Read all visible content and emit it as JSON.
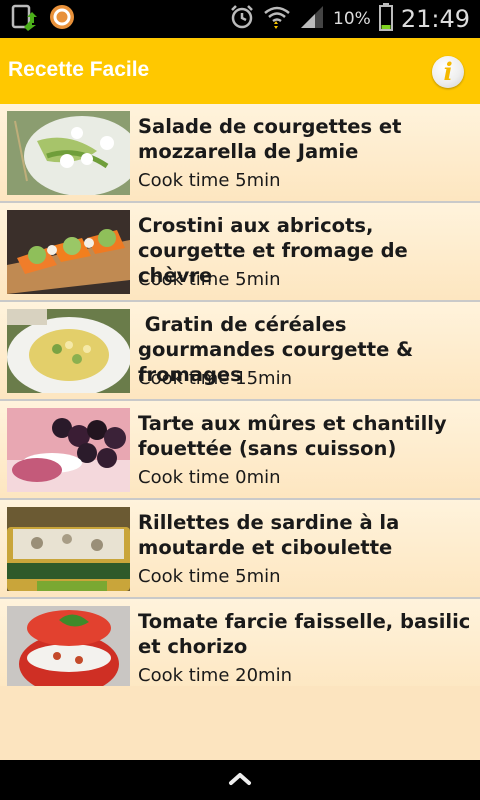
{
  "status_bar": {
    "battery_percent": "10%",
    "time": "21:49",
    "icons": [
      "upload-notification-icon",
      "app-notification-icon",
      "alarm-icon",
      "wifi-icon",
      "signal-icon",
      "battery-icon"
    ]
  },
  "action_bar": {
    "title": "Recette Facile",
    "info_icon": "info-icon",
    "accent_color": "#ffc800"
  },
  "recipes": [
    {
      "title": "Salade de courgettes et mozzarella de Jamie",
      "cook_time": "Cook time 5min"
    },
    {
      "title": "Crostini aux abricots, courgette et fromage de chèvre",
      "cook_time": "Cook time 5min"
    },
    {
      "title": " Gratin de céréales gourmandes courgette & fromages",
      "cook_time": "Cook time 15min"
    },
    {
      "title": "Tarte aux mûres et chantilly fouettée (sans cuisson)",
      "cook_time": "Cook time 0min"
    },
    {
      "title": "Rillettes de sardine à la moutarde et ciboulette",
      "cook_time": "Cook time 5min"
    },
    {
      "title": "Tomate farcie faisselle, basilic et chorizo",
      "cook_time": "Cook time 20min"
    }
  ],
  "bottom_bar": {
    "icon": "chevron-up-icon"
  }
}
